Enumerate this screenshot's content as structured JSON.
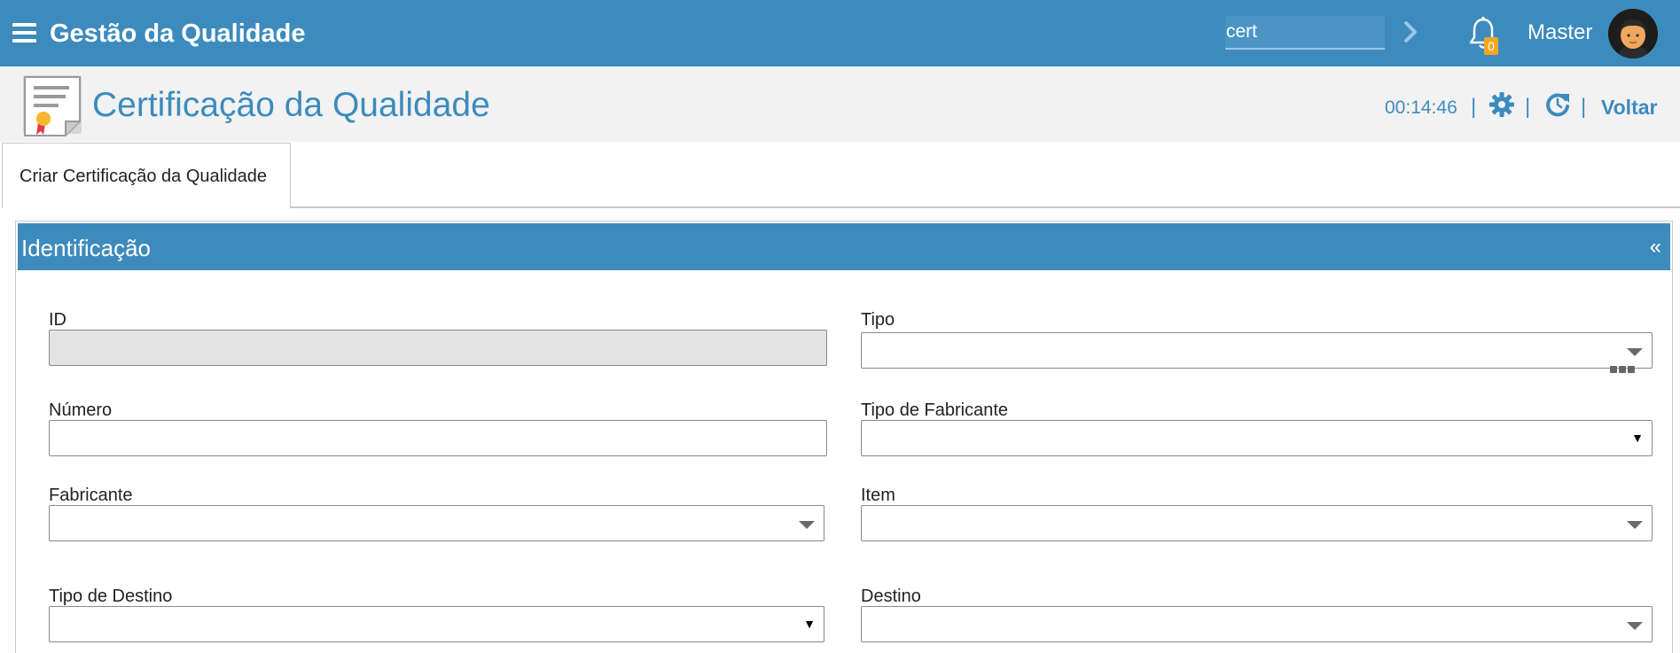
{
  "app": {
    "title": "Gestão da Qualidade"
  },
  "search": {
    "value": "cert"
  },
  "notifications": {
    "count": "0"
  },
  "user": {
    "name": "Master"
  },
  "page": {
    "title": "Certificação da Qualidade",
    "timer": "00:14:46",
    "separator": "|",
    "back_label": "Voltar"
  },
  "tabs": [
    {
      "label": "Criar Certificação da Qualidade"
    }
  ],
  "panel": {
    "title": "Identificação",
    "collapse": "«"
  },
  "form": {
    "id": {
      "label": "ID",
      "value": ""
    },
    "tipo": {
      "label": "Tipo",
      "value": ""
    },
    "numero": {
      "label": "Número",
      "value": ""
    },
    "tipo_fabricante": {
      "label": "Tipo de Fabricante",
      "value": ""
    },
    "fabricante": {
      "label": "Fabricante",
      "value": ""
    },
    "item": {
      "label": "Item",
      "value": ""
    },
    "tipo_destino": {
      "label": "Tipo de Destino",
      "value": ""
    },
    "destino": {
      "label": "Destino",
      "value": ""
    }
  },
  "colors": {
    "brand": "#3d8bbd",
    "badge": "#f5a623"
  }
}
